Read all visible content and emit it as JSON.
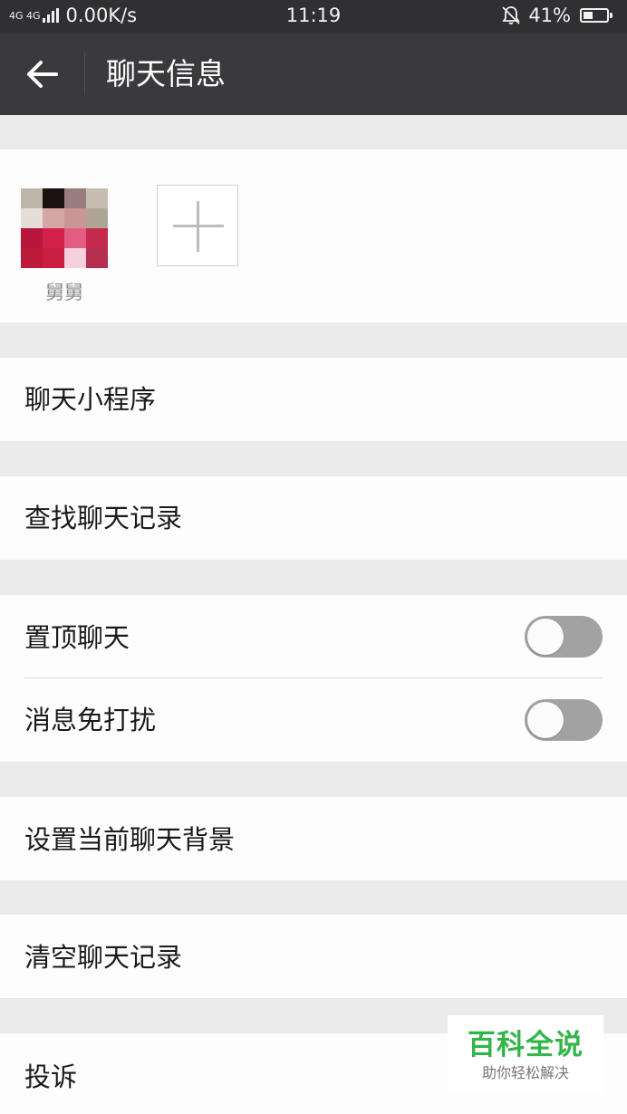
{
  "status_bar": {
    "network": "4G 4G",
    "speed": "0.00K/s",
    "time": "11:19",
    "battery_percent": "41%",
    "battery_level": 0.41
  },
  "header": {
    "title": "聊天信息",
    "back_icon": "arrow-left-icon"
  },
  "members": {
    "items": [
      {
        "name": "舅舅"
      }
    ],
    "add_icon": "plus-icon"
  },
  "menu": {
    "mini_program": "聊天小程序",
    "search_history": "查找聊天记录",
    "pin_chat": {
      "label": "置顶聊天",
      "on": false
    },
    "mute": {
      "label": "消息免打扰",
      "on": false
    },
    "set_background": "设置当前聊天背景",
    "clear_history": "清空聊天记录",
    "report": "投诉"
  },
  "watermark": {
    "title": "百科全说",
    "subtitle": "助你轻松解决",
    "color": "#33b54a"
  },
  "colors": {
    "toolbar": "#3a3a3d",
    "statusbar": "#303033",
    "switch_off": "#a2a2a2"
  }
}
